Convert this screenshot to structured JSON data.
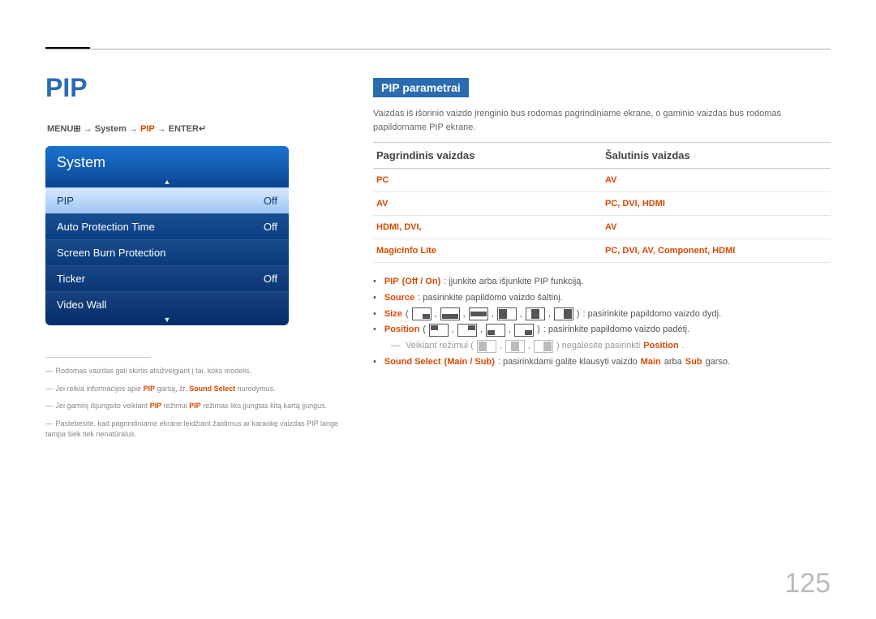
{
  "page": {
    "title": "PIP",
    "page_number": "125"
  },
  "breadcrumb": {
    "menu": "MENU",
    "menu_icon": "⊞",
    "arrow": " → ",
    "system": "System",
    "pip": "PIP",
    "enter": "ENTER",
    "enter_icon": "↵"
  },
  "menu": {
    "header": "System",
    "arrow_up": "▲",
    "arrow_down": "▼",
    "rows": [
      {
        "label": "PIP",
        "value": "Off",
        "selected": true
      },
      {
        "label": "Auto Protection Time",
        "value": "Off"
      },
      {
        "label": "Screen Burn Protection",
        "value": ""
      },
      {
        "label": "Ticker",
        "value": "Off"
      },
      {
        "label": "Video Wall",
        "value": ""
      }
    ]
  },
  "notes": {
    "items": [
      {
        "pre": "Rodomas vaizdas gali skirtis atsižvelgiant į tai, koks modelis."
      },
      {
        "pre": "Jei reikia informacijos apie ",
        "hl1": "PIP",
        "mid": " garsą, žr. ",
        "hl2": "Sound Select",
        "post": " nurodymus."
      },
      {
        "pre": "Jei gaminį išjungsite veikiant ",
        "hl1": "PIP",
        "mid": " režimui ",
        "hl2": "PIP",
        "post": " režimas liks įjungtas kitą kartą įjungus."
      },
      {
        "pre": "Pastebėsite, kad pagrindiniame ekrane leidžiant žaidimus ar karaokę vaizdas PIP lange tampa šiek tiek nenatūralus."
      }
    ]
  },
  "right": {
    "section": "PIP parametrai",
    "intro": "Vaizdas iš išorinio vaizdo įrenginio bus rodomas pagrindiniame ekrane, o gaminio vaizdas bus rodomas papildomame PIP ekrane.",
    "th1": "Pagrindinis vaizdas",
    "th2": "Šalutinis vaizdas",
    "rows": [
      [
        "PC",
        "AV"
      ],
      [
        "AV",
        "PC, DVI, HDMI"
      ],
      [
        "HDMI, DVI,",
        "AV"
      ],
      [
        "MagicInfo Lite",
        "PC, DVI, AV, Component, HDMI"
      ]
    ],
    "b": {
      "pip_label": "PIP",
      "pip_vals": " (Off / On)",
      "pip_text": ": įjunkite arba išjunkite PIP funkciją.",
      "source_label": "Source",
      "source_text": ": pasirinkite papildomo vaizdo šaltinį.",
      "size_label": "Size",
      "size_text": ": pasirinkite papildomo vaizdo dydį.",
      "position_label": "Position",
      "position_text": ": pasirinkite papildomo vaizdo padėtį.",
      "mode_pre": "Veikiant režimui (",
      "mode_post": ") negalėsite pasirinkti ",
      "mode_hl": "Position",
      "sound_label": "Sound Select",
      "sound_vals": " (Main / Sub)",
      "sound_text1": ": pasirinkdami galite klausyti vaizdo ",
      "sound_main": "Main",
      "sound_text2": " arba ",
      "sound_sub": "Sub",
      "sound_text3": " garso."
    }
  }
}
